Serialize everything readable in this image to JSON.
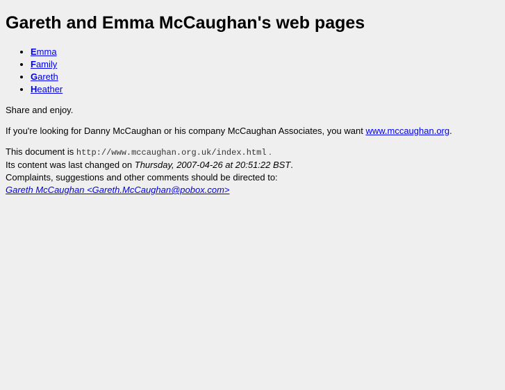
{
  "title": "Gareth and Emma McCaughan's web pages",
  "nav": [
    {
      "initial": "E",
      "rest": "mma"
    },
    {
      "initial": "F",
      "rest": "amily"
    },
    {
      "initial": "G",
      "rest": "areth"
    },
    {
      "initial": "H",
      "rest": "eather"
    }
  ],
  "share": "Share and enjoy.",
  "danny": {
    "text": "If you're looking for Danny McCaughan or his company McCaughan Associates, you want",
    "link": "www.mccaughan.org",
    "end": "."
  },
  "footer": {
    "doc_prefix": "This document is",
    "doc_url": "http://www.mccaughan.org.uk/index.html",
    "doc_end": ".",
    "changed_prefix": "Its content was last changed on",
    "changed_date": "Thursday, 2007-04-26 at 20:51:22 BST",
    "changed_end": ".",
    "complaints": "Complaints, suggestions and other comments should be directed to:",
    "contact": "Gareth McCaughan <Gareth.McCaughan@pobox.com>"
  }
}
